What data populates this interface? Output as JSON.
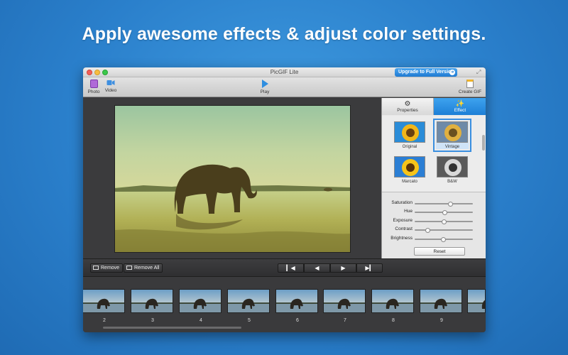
{
  "headline": "Apply awesome effects & adjust color settings.",
  "window": {
    "title": "PicGIF Lite",
    "upgrade_label": "Upgrade to Full Version"
  },
  "toolbar": {
    "photo_label": "Photo",
    "video_label": "Video",
    "play_label": "Play",
    "create_label": "Create GIF"
  },
  "side_panel": {
    "tabs": [
      {
        "label": "Properties",
        "icon": "gear-icon"
      },
      {
        "label": "Effect",
        "icon": "magic-wand-icon"
      }
    ],
    "active_tab": "Effect",
    "effects": [
      {
        "label": "Original"
      },
      {
        "label": "Vintage",
        "selected": true
      },
      {
        "label": "Marcato"
      },
      {
        "label": "B&W"
      }
    ],
    "adjustments": [
      {
        "label": "Saturation",
        "level": 0.62
      },
      {
        "label": "Hue",
        "level": 0.52
      },
      {
        "label": "Exposure",
        "level": 0.5
      },
      {
        "label": "Contrast",
        "level": 0.22
      },
      {
        "label": "Brightness",
        "level": 0.49
      }
    ],
    "reset_label": "Reset"
  },
  "controls": {
    "remove_label": "Remove",
    "remove_all_label": "Remove All",
    "nav_icons": [
      "skip-first-icon",
      "previous-icon",
      "next-icon",
      "skip-last-icon"
    ]
  },
  "filmstrip": {
    "frame_numbers": [
      "2",
      "3",
      "4",
      "5",
      "6",
      "7",
      "8",
      "9"
    ]
  },
  "colors": {
    "accent": "#2f8ee0",
    "background": "#2a7fcb"
  }
}
